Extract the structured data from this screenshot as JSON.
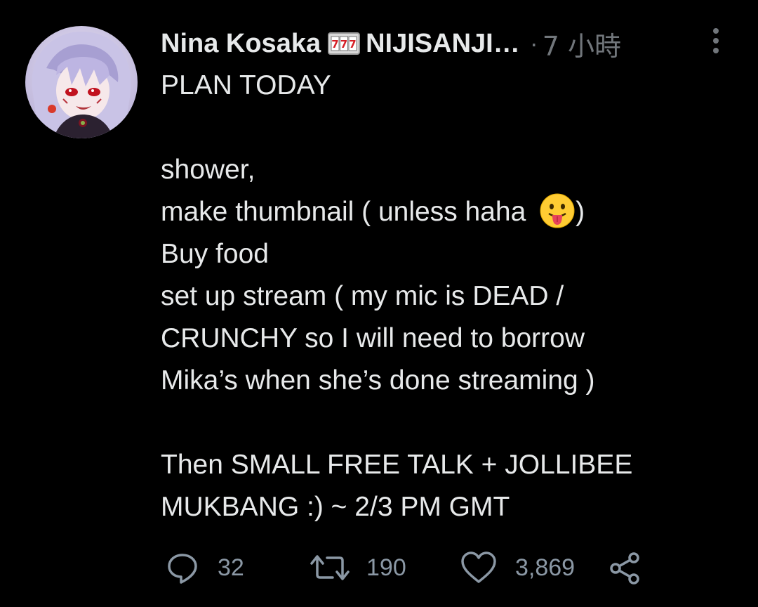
{
  "tweet": {
    "author": {
      "name": "Nina Kosaka",
      "badge_icon": "slot-machine-777-icon",
      "handle": "NIJISANJI…",
      "separator": "·",
      "time": "7 小時"
    },
    "lines": [
      "PLAN TODAY",
      "",
      "shower,",
      "make thumbnail ( unless haha ",
      "Buy food",
      "set up stream ( my mic is DEAD /",
      "CRUNCHY so I will need to borrow",
      "Mika’s when she’s done streaming )",
      "",
      "Then SMALL FREE TALK + JOLLIBEE",
      "MUKBANG :) ~ 2/3 PM GMT"
    ],
    "emoji_suffix": ")",
    "emoji_icon": "tongue-out-face-icon",
    "actions": {
      "reply_count": "32",
      "retweet_count": "190",
      "like_count": "3,869"
    }
  },
  "colors": {
    "background": "#000000",
    "text": "#e7e9ea",
    "muted": "#71767b",
    "action": "#8b98a5"
  }
}
